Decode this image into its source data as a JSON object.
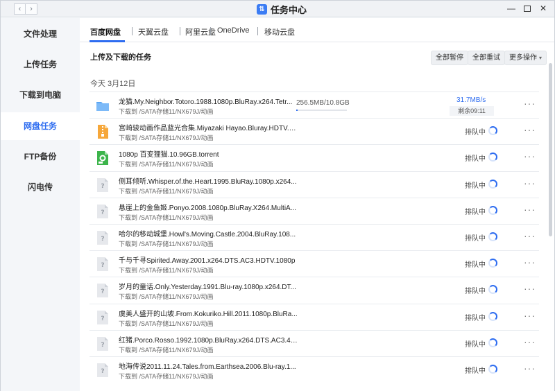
{
  "titlebar": {
    "title": "任务中心",
    "back": "‹",
    "forward": "›",
    "minimize": "—",
    "close": "✕"
  },
  "sidebar": {
    "items": [
      {
        "label": "文件处理",
        "active": false
      },
      {
        "label": "上传任务",
        "active": false
      },
      {
        "label": "下载到电脑",
        "active": false
      },
      {
        "label": "网盘任务",
        "active": true
      },
      {
        "label": "FTP备份",
        "active": false
      },
      {
        "label": "闪电传",
        "active": false
      }
    ]
  },
  "tabs": [
    {
      "label": "百度网盘",
      "active": true
    },
    {
      "label": "天翼云盘",
      "active": false
    },
    {
      "label": "阿里云盘",
      "active": false
    },
    {
      "label": "OneDrive",
      "active": false
    },
    {
      "label": "移动云盘",
      "active": false
    }
  ],
  "section": {
    "title": "上传及下载的任务"
  },
  "toolbar": {
    "pause_all": "全部暂停",
    "retry_all": "全部重试",
    "more_ops": "更多操作",
    "more_caret": "▾"
  },
  "date_label": "今天 3月12日",
  "more_glyph": "···",
  "accent_color": "#2d6cf0",
  "tasks": [
    {
      "icon": "folder-icon",
      "name": "龙猫.My.Neighbor.Totoro.1988.1080p.BluRay.x264.Tetr...",
      "path": "下载到 /SATA存储11/NX679J/动画",
      "size": "256.5MB/10.8GB",
      "progress": 0.024,
      "speed": "31.7MB/s",
      "remaining": "剩余09:11"
    },
    {
      "icon": "archive-file-icon",
      "name": "宫崎骏动画作品蓝光合集.Miyazaki Hayao.Bluray.HDTV.72...",
      "path": "下载到 /SATA存储11/NX679J/动画",
      "status": "排队中"
    },
    {
      "icon": "torrent-file-icon",
      "name": "1080p 百变狸猫.10.96GB.torrent",
      "path": "下载到 /SATA存储11/NX679J/动画",
      "status": "排队中"
    },
    {
      "icon": "unknown-file-icon",
      "name": "侧耳倾听.Whisper.of.the.Heart.1995.BluRay.1080p.x264...",
      "path": "下载到 /SATA存储11/NX679J/动画",
      "status": "排队中"
    },
    {
      "icon": "unknown-file-icon",
      "name": "悬崖上的金鱼姬.Ponyo.2008.1080p.BluRay.X264.MultiA...",
      "path": "下载到 /SATA存储11/NX679J/动画",
      "status": "排队中"
    },
    {
      "icon": "unknown-file-icon",
      "name": "哈尔的移动城堡.Howl's.Moving.Castle.2004.BluRay.108...",
      "path": "下载到 /SATA存储11/NX679J/动画",
      "status": "排队中"
    },
    {
      "icon": "unknown-file-icon",
      "name": "千与千寻Spirited.Away.2001.x264.DTS.AC3.HDTV.1080p",
      "path": "下载到 /SATA存储11/NX679J/动画",
      "status": "排队中"
    },
    {
      "icon": "unknown-file-icon",
      "name": "岁月的童话.Only.Yesterday.1991.Blu-ray.1080p.x264.DT...",
      "path": "下载到 /SATA存储11/NX679J/动画",
      "status": "排队中"
    },
    {
      "icon": "unknown-file-icon",
      "name": "虞美人盛开的山坡.From.Kokuriko.Hill.2011.1080p.BluRa...",
      "path": "下载到 /SATA存储11/NX679J/动画",
      "status": "排队中"
    },
    {
      "icon": "unknown-file-icon",
      "name": "红猪.Porco.Rosso.1992.1080p.BluRay.x264.DTS.AC3.4A...",
      "path": "下载到 /SATA存储11/NX679J/动画",
      "status": "排队中"
    },
    {
      "icon": "unknown-file-icon",
      "name": "地海传说2011.11.24.Tales.from.Earthsea.2006.Blu-ray.1...",
      "path": "下载到 /SATA存储11/NX679J/动画",
      "status": "排队中"
    }
  ]
}
